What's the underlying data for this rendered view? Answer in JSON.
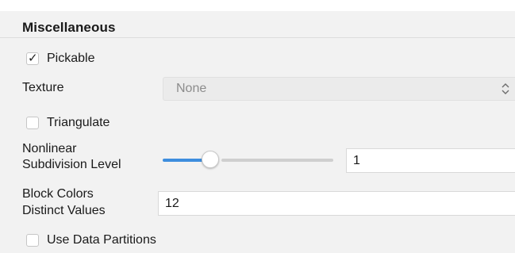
{
  "section": {
    "title": "Miscellaneous"
  },
  "pickable": {
    "label": "Pickable",
    "checked": true
  },
  "texture": {
    "label": "Texture",
    "value": "None"
  },
  "triangulate": {
    "label": "Triangulate",
    "checked": false
  },
  "nonlinear": {
    "label_line1": "Nonlinear",
    "label_line2": "Subdivision Level",
    "slider_fraction": 0.28,
    "value": "1"
  },
  "block_colors": {
    "label_line1": "Block Colors",
    "label_line2": "Distinct Values",
    "value": "12"
  },
  "data_partitions": {
    "label": "Use Data Partitions",
    "checked": false
  },
  "colors": {
    "accent": "#3e8ede",
    "panel_bg": "#f2f2f2"
  },
  "icons": {
    "check": "checkmark-icon",
    "select": "updown-chevron-icon"
  }
}
